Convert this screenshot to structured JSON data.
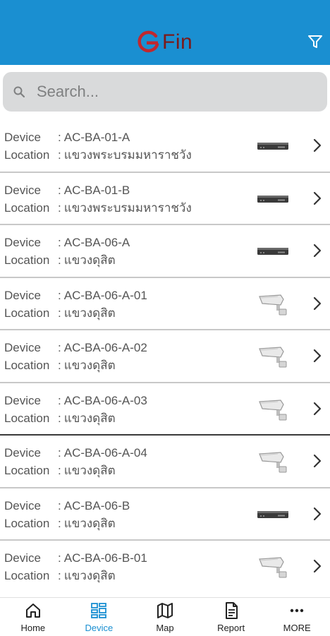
{
  "app": {
    "logo_text": "Fin",
    "brand_color": "#1a8fd1",
    "logo_color": "#c0282f"
  },
  "search": {
    "placeholder": "Search..."
  },
  "list": {
    "device_label": "Device",
    "location_label": "Location",
    "separator": ":",
    "items": [
      {
        "device": "AC-BA-01-A",
        "location": "แขวงพระบรมมหาราชวัง",
        "icon": "nvr-recorder-icon"
      },
      {
        "device": "AC-BA-01-B",
        "location": "แขวงพระบรมมหาราชวัง",
        "icon": "nvr-recorder-icon"
      },
      {
        "device": "AC-BA-06-A",
        "location": "แขวงดุสิต",
        "icon": "nvr-recorder-icon"
      },
      {
        "device": "AC-BA-06-A-01",
        "location": "แขวงดุสิต",
        "icon": "cctv-camera-icon"
      },
      {
        "device": "AC-BA-06-A-02",
        "location": "แขวงดุสิต",
        "icon": "cctv-camera-icon"
      },
      {
        "device": "AC-BA-06-A-03",
        "location": "แขวงดุสิต",
        "icon": "cctv-camera-icon"
      },
      {
        "device": "AC-BA-06-A-04",
        "location": "แขวงดุสิต",
        "icon": "cctv-camera-icon"
      },
      {
        "device": "AC-BA-06-B",
        "location": "แขวงดุสิต",
        "icon": "nvr-recorder-icon"
      },
      {
        "device": "AC-BA-06-B-01",
        "location": "แขวงดุสิต",
        "icon": "cctv-camera-icon"
      }
    ]
  },
  "tabs": [
    {
      "label": "Home",
      "icon": "home-icon",
      "active": false
    },
    {
      "label": "Device",
      "icon": "device-grid-icon",
      "active": true
    },
    {
      "label": "Map",
      "icon": "map-icon",
      "active": false
    },
    {
      "label": "Report",
      "icon": "report-icon",
      "active": false
    },
    {
      "label": "MORE",
      "icon": "more-dots-icon",
      "active": false
    }
  ]
}
